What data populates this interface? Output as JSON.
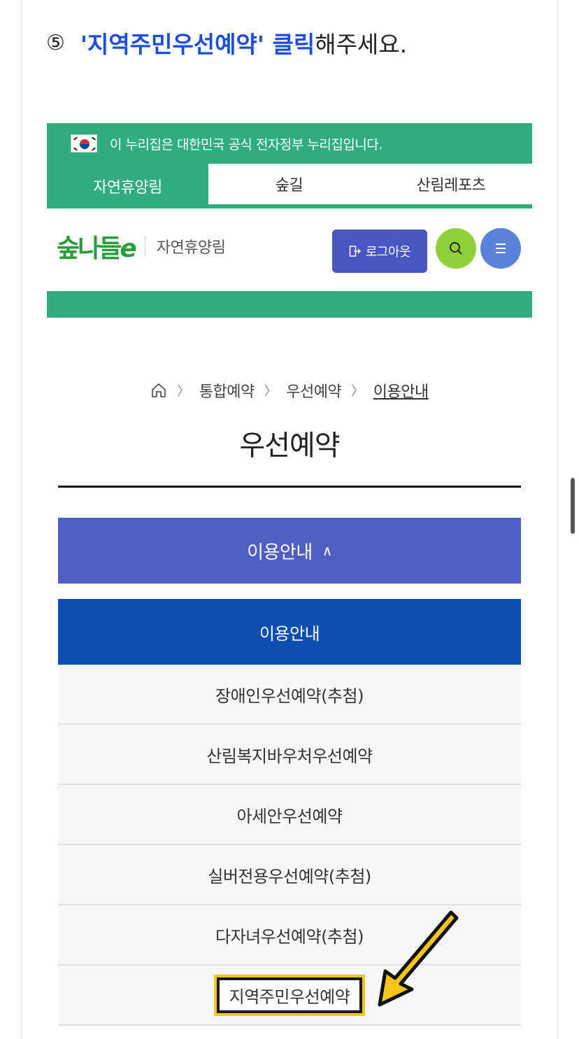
{
  "instruction": {
    "number": "⑤",
    "highlight": "'지역주민우선예약' 클릭",
    "rest": "해주세요."
  },
  "gov_bar": {
    "text": "이 누리집은 대한민국 공식 전자정부 누리집입니다."
  },
  "tabs": [
    {
      "label": "자연휴양림",
      "active": true
    },
    {
      "label": "숲길",
      "active": false
    },
    {
      "label": "산림레포츠",
      "active": false
    }
  ],
  "header": {
    "logo_text": "숲나들",
    "logo_e": "e",
    "site_name": "자연휴양림",
    "logout_label": "로그아웃",
    "search_icon": "search-icon",
    "menu_icon": "menu-icon"
  },
  "breadcrumb": {
    "items": [
      "통합예약",
      "우선예약",
      "이용안내"
    ]
  },
  "page_title": "우선예약",
  "submenu": {
    "toggle_label": "이용안내",
    "chevron": "∧",
    "items": [
      {
        "label": "이용안내",
        "active": true
      },
      {
        "label": "장애인우선예약(추첨)"
      },
      {
        "label": "산림복지바우처우선예약"
      },
      {
        "label": "아세안우선예약"
      },
      {
        "label": "실버전용우선예약(추첨)"
      },
      {
        "label": "다자녀우선예약(추첨)"
      },
      {
        "label": "지역주민우선예약",
        "marked": true
      }
    ]
  },
  "colors": {
    "green": "#2fad7e",
    "indigo": "#4f5ec1",
    "active_blue": "#0b4fb0",
    "highlight_text": "#1a4de0",
    "arrow_yellow": "#f5c518"
  }
}
